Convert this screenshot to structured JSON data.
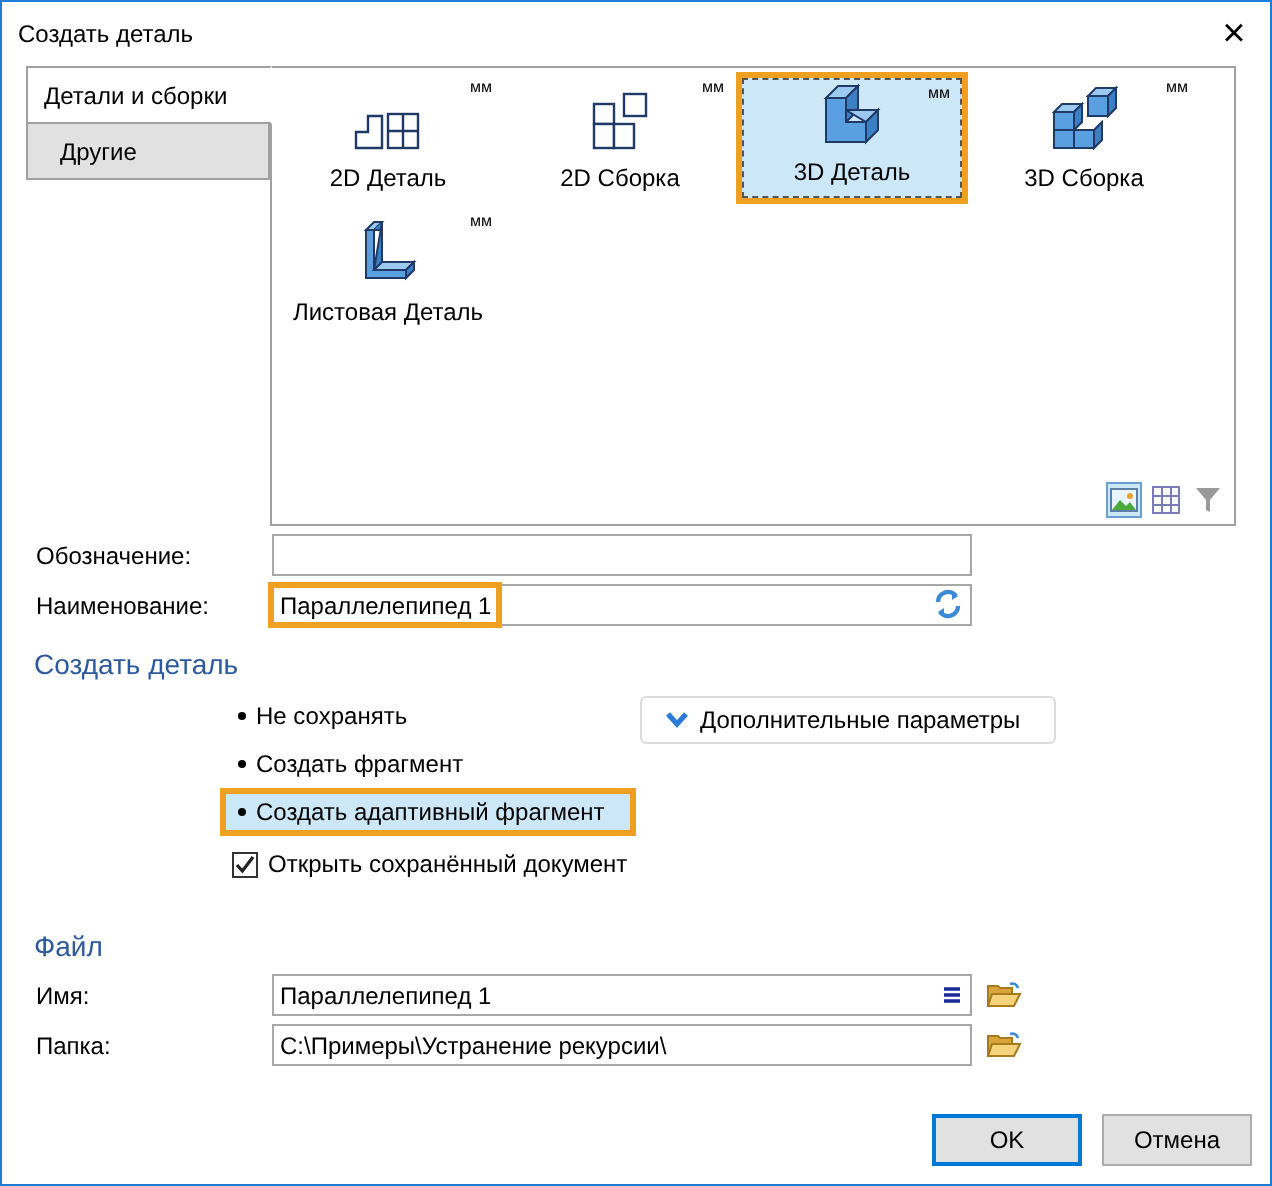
{
  "window": {
    "title": "Создать деталь",
    "close": "×"
  },
  "tabs": [
    {
      "label": "Детали и сборки",
      "selected": true
    },
    {
      "label": "Другие",
      "selected": false
    }
  ],
  "templates": [
    {
      "kind": "part2d",
      "label": "2D Деталь",
      "units": "мм",
      "selected": false
    },
    {
      "kind": "assembly2d",
      "label": "2D Сборка",
      "units": "мм",
      "selected": false
    },
    {
      "kind": "part3d",
      "label": "3D Деталь",
      "units": "мм",
      "selected": true,
      "highlighted": true
    },
    {
      "kind": "assembly3d",
      "label": "3D Сборка",
      "units": "мм",
      "selected": false
    },
    {
      "kind": "sheet",
      "label": "Листовая Деталь",
      "units": "мм",
      "selected": false
    }
  ],
  "view_buttons": [
    {
      "kind": "pictures",
      "selected": true
    },
    {
      "kind": "grid",
      "selected": false
    },
    {
      "kind": "filter",
      "selected": false
    }
  ],
  "fields": [
    {
      "label": "Обозначение:",
      "highlighted": false
    },
    {
      "label": "Наименование:",
      "value": "Параллелепипед 1",
      "highlighted": true
    }
  ],
  "create_section": {
    "title": "Создать деталь",
    "options": [
      {
        "label": "Не сохранять",
        "selected": false,
        "highlighted": false
      },
      {
        "label": "Создать фрагмент",
        "selected": false,
        "highlighted": false
      },
      {
        "label": "Создать адаптивный фрагмент",
        "selected": true,
        "highlighted": true
      }
    ],
    "more_button": {
      "label": "Дополнительные параметры",
      "expanded": false
    },
    "open_saved": {
      "label": "Открыть сохранённый документ",
      "checked": true
    }
  },
  "file_section": {
    "title": "Файл",
    "fields": [
      {
        "label": "Имя:",
        "value": "Параллелепипед 1",
        "kind": "name"
      },
      {
        "label": "Папка:",
        "value": "C:\\Примеры\\Устранение рекурсии\\",
        "kind": "folder"
      }
    ]
  },
  "buttons": [
    {
      "label": "OK",
      "kind": "default"
    },
    {
      "label": "Отмена",
      "kind": "normal"
    }
  ]
}
